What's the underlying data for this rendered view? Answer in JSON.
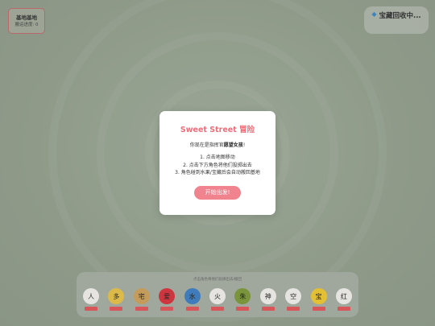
{
  "base": {
    "title": "基地基地",
    "progress": "搬运进度: 0"
  },
  "treasure": {
    "icon": "gem-icon",
    "label": "宝藏回收中..."
  },
  "modal": {
    "title": "Sweet Street 冒险",
    "intro_prefix": "你现在是指挥官",
    "intro_bold": "愿望女孩",
    "intro_suffix": "!",
    "steps": [
      "1. 点击地图移动",
      "2. 点击下方角色将他们投掷出去",
      "3. 角色碰到水果/宝藏后会自动搬回基地"
    ],
    "start_button": "开始出发!"
  },
  "dock": {
    "hint": "点击角色将他们投掷出去/搬回",
    "characters": [
      {
        "glyph": "人",
        "color": "#f2f0ee"
      },
      {
        "glyph": "多",
        "color": "#e8c34a"
      },
      {
        "glyph": "宅",
        "color": "#cfa15c"
      },
      {
        "glyph": "爱",
        "color": "#d8323e"
      },
      {
        "glyph": "水",
        "color": "#3f7fc6"
      },
      {
        "glyph": "火",
        "color": "#f2f0ee"
      },
      {
        "glyph": "朱",
        "color": "#7e9a3a"
      },
      {
        "glyph": "神",
        "color": "#f2f0ee"
      },
      {
        "glyph": "空",
        "color": "#f2f0ee"
      },
      {
        "glyph": "宝",
        "color": "#f0c832"
      },
      {
        "glyph": "红",
        "color": "#f2f0ee"
      }
    ]
  }
}
